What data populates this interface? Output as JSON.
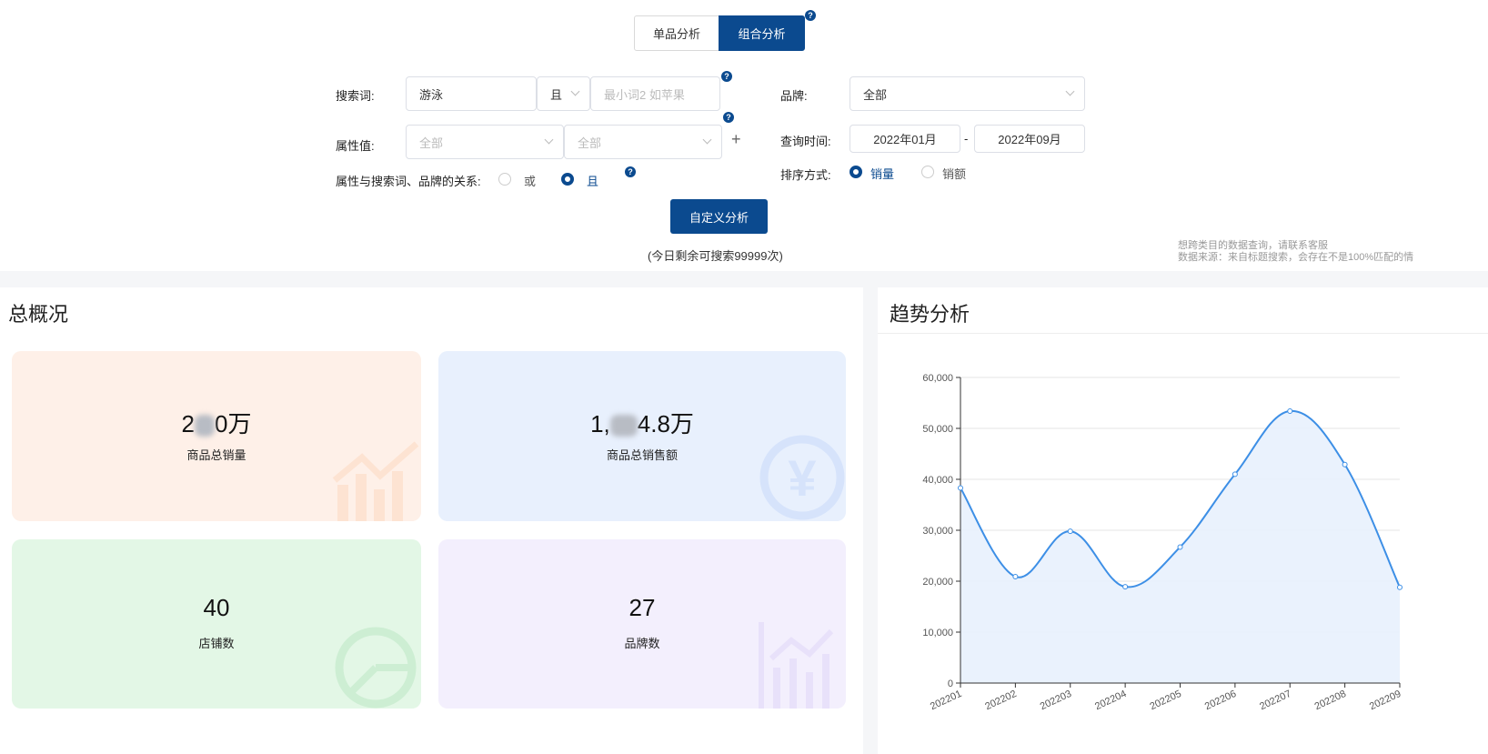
{
  "tabs": [
    {
      "label": "单品分析",
      "active": false
    },
    {
      "label": "组合分析",
      "active": true
    }
  ],
  "form": {
    "search_label": "搜索词:",
    "search_value": "游泳",
    "logic_select": "且",
    "search2_placeholder": "最小词2 如苹果",
    "attr_label": "属性值:",
    "attr1_placeholder": "全部",
    "attr2_placeholder": "全部",
    "add_icon": "+",
    "relation_label": "属性与搜索词、品牌的关系:",
    "relation_options": [
      "或",
      "且"
    ],
    "relation_selected": "且",
    "brand_label": "品牌:",
    "brand_value": "全部",
    "time_label": "查询时间:",
    "time_start": "2022年01月",
    "time_sep": "-",
    "time_end": "2022年09月",
    "sort_label": "排序方式:",
    "sort_options": [
      "销量",
      "销额"
    ],
    "sort_selected": "销量",
    "submit": "自定义分析",
    "remaining": "(今日剩余可搜索99999次)"
  },
  "notes": [
    "想跨类目的数据查询，请联系客服",
    "数据来源：来自标题搜索，会存在不是100%匹配的情"
  ],
  "overview": {
    "title": "总概况",
    "cards": [
      {
        "value_a": "2",
        "value_b": "0万",
        "label": "商品总销量",
        "bg": "#fef0e8"
      },
      {
        "value_a": "1,",
        "value_b": "4.8万",
        "label": "商品总销售额",
        "bg": "#e8f0fd"
      },
      {
        "value": "40",
        "label": "店铺数",
        "bg": "#e3f7e6"
      },
      {
        "value": "27",
        "label": "品牌数",
        "bg": "#f3effd"
      }
    ]
  },
  "trend": {
    "title": "趋势分析"
  },
  "chart_data": {
    "type": "area",
    "title": "趋势分析",
    "xlabel": "",
    "ylabel": "",
    "categories": [
      "202201",
      "202202",
      "202203",
      "202204",
      "202205",
      "202206",
      "202207",
      "202208",
      "202209"
    ],
    "values": [
      38300,
      20900,
      29800,
      18900,
      26700,
      41000,
      53400,
      42900,
      18800
    ],
    "ylim": [
      0,
      60000
    ],
    "yticks": [
      0,
      10000,
      20000,
      30000,
      40000,
      50000,
      60000
    ],
    "yticklabels": [
      "0",
      "10,000",
      "20,000",
      "30,000",
      "40,000",
      "50,000",
      "60,000"
    ],
    "grid": true,
    "color": "#3d8fe6"
  }
}
